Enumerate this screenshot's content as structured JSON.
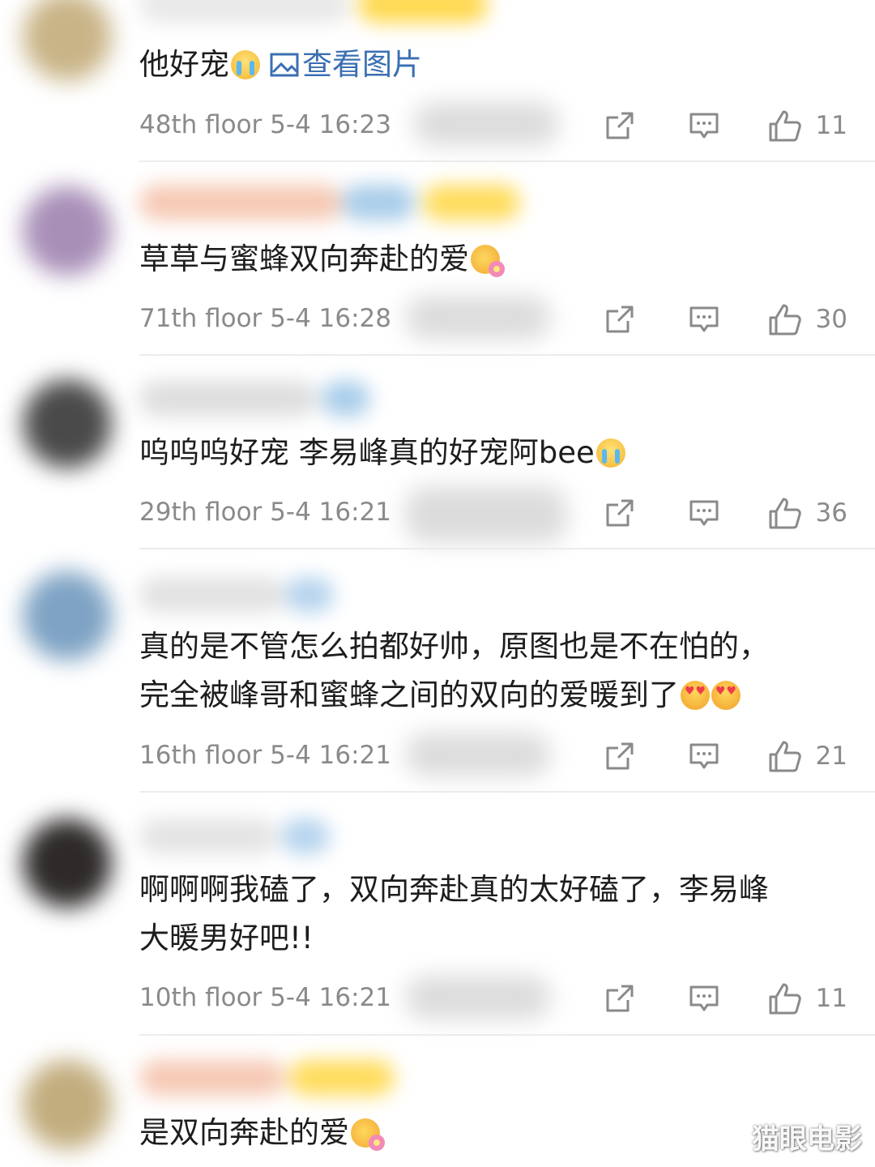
{
  "comments": [
    {
      "text": "他好宠",
      "link": "查看图片",
      "meta": "48th floor 5-4 16:23",
      "likes": "11",
      "emojis": [
        "loudly-crying-face"
      ]
    },
    {
      "text": "草草与蜜蜂双向奔赴的爱",
      "meta": "71th floor 5-4 16:28",
      "likes": "30",
      "emojis": [
        "flower-face"
      ]
    },
    {
      "text": "呜呜呜好宠 李易峰真的好宠阿bee",
      "meta": "29th floor 5-4 16:21",
      "likes": "36",
      "emojis": [
        "loudly-crying-face"
      ]
    },
    {
      "text_line1": "真的是不管怎么拍都好帅，原图也是不在怕的，",
      "text_line2": "完全被峰哥和蜜蜂之间的双向的爱暖到了",
      "meta": "16th floor 5-4 16:21",
      "likes": "21",
      "emojis": [
        "heart-eyes-face",
        "heart-eyes-face"
      ]
    },
    {
      "text_line1": "啊啊啊我磕了，双向奔赴真的太好磕了，李易峰",
      "text_line2": "大暖男好吧!!",
      "meta": "10th floor 5-4 16:21",
      "likes": "11"
    },
    {
      "text": "是双向奔赴的爱",
      "emojis": [
        "flower-face"
      ]
    }
  ],
  "watermark": "猫眼电影",
  "colors": {
    "text": "#1d1d1d",
    "meta": "#8a8a8a",
    "link": "#3a6fb2",
    "divider": "#ececec"
  },
  "icons": [
    "share-icon",
    "reply-icon",
    "thumbs-up-icon",
    "image-icon"
  ]
}
